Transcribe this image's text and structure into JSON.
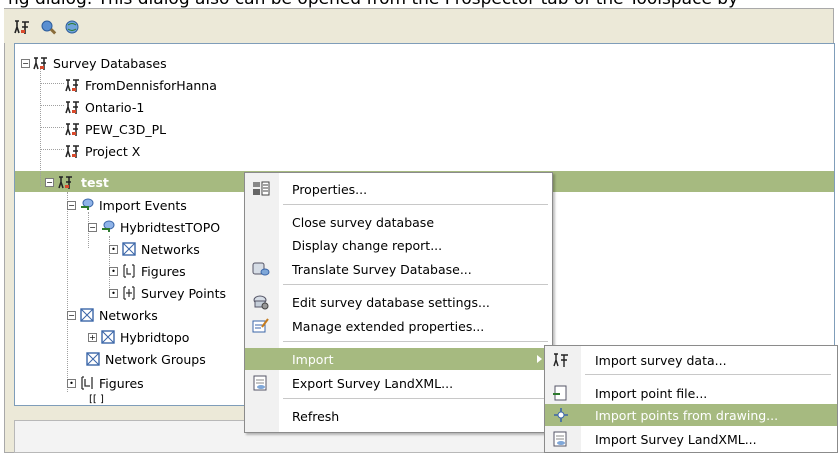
{
  "caption_fragment": "ng dialog. This dialog also can be opened from the Prospector tab of the Toolspace by",
  "toolbar": {
    "buttons": [
      "survey-databases-icon",
      "view-icon",
      "globe-icon"
    ]
  },
  "tree": {
    "root": "Survey Databases",
    "databases": [
      "FromDennisforHanna",
      "Ontario-1",
      "PEW_C3D_PL",
      "Project X"
    ],
    "selected": "test",
    "children": {
      "import_events": "Import Events",
      "event_name": "HybridtestTOPO",
      "event_children": [
        "Networks",
        "Figures",
        "Survey Points"
      ],
      "networks": "Networks",
      "network_child": "Hybridtopo",
      "network_groups": "Network Groups",
      "figures": "Figures",
      "partial": "[[ ]"
    }
  },
  "context_menu": {
    "items": [
      {
        "label": "Properties...",
        "icon": "properties-icon"
      },
      {
        "label": "Close survey database",
        "icon": ""
      },
      {
        "label": "Display change report...",
        "icon": ""
      },
      {
        "label": "Translate Survey Database...",
        "icon": "translate-database-icon"
      },
      {
        "label": "Edit survey database settings...",
        "icon": "edit-settings-icon"
      },
      {
        "label": "Manage extended properties...",
        "icon": "manage-properties-icon"
      },
      {
        "label": "Import",
        "icon": ""
      },
      {
        "label": "Export Survey LandXML...",
        "icon": "export-landxml-icon"
      },
      {
        "label": "Refresh",
        "icon": ""
      }
    ],
    "highlight_color": "#a6ba80"
  },
  "import_submenu": {
    "items": [
      {
        "label": "Import survey data...",
        "icon": "import-survey-data-icon"
      },
      {
        "label": "Import point file...",
        "icon": "import-point-file-icon"
      },
      {
        "label": "Import points from drawing...",
        "icon": "import-points-drawing-icon"
      },
      {
        "label": "Import Survey LandXML...",
        "icon": "import-landxml-icon"
      }
    ]
  }
}
